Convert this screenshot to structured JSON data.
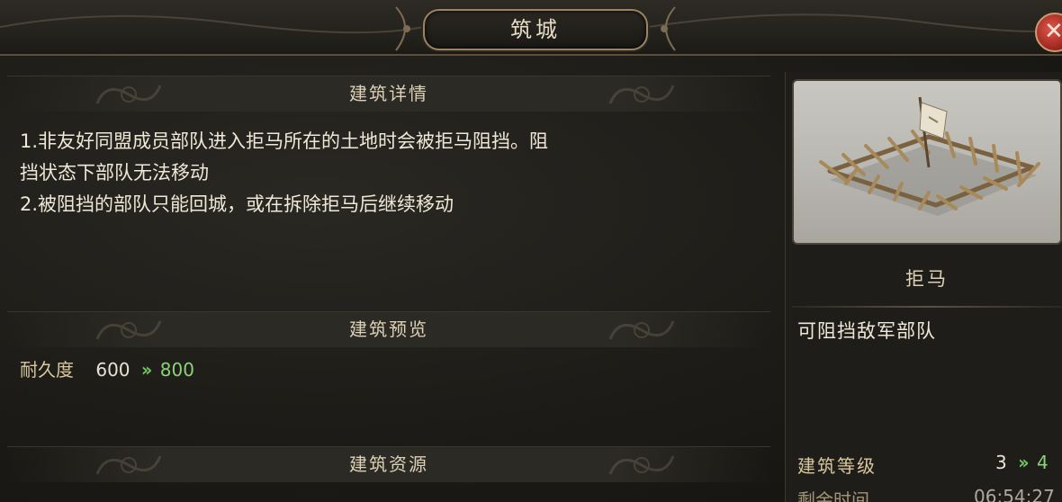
{
  "window": {
    "title": "筑城",
    "close_icon": "close-icon"
  },
  "details": {
    "header": "建筑详情",
    "lines": [
      "1.非友好同盟成员部队进入拒马所在的土地时会被拒马阻挡。阻",
      "挡状态下部队无法移动",
      "2.被阻挡的部队只能回城，或在拆除拒马后继续移动"
    ]
  },
  "preview": {
    "header": "建筑预览",
    "durability_label": "耐久度",
    "durability_current": "600",
    "durability_next": "800"
  },
  "resources": {
    "header": "建筑资源"
  },
  "building": {
    "name": "拒马",
    "description": "可阻挡敌军部队",
    "level_label": "建筑等级",
    "level_current": "3",
    "level_next": "4",
    "time_label": "剩余时间",
    "time_value": "06:54:27"
  },
  "colors": {
    "accent_green": "#6fc55e",
    "text_gold": "#d9c79e",
    "close_red": "#a42a22"
  }
}
